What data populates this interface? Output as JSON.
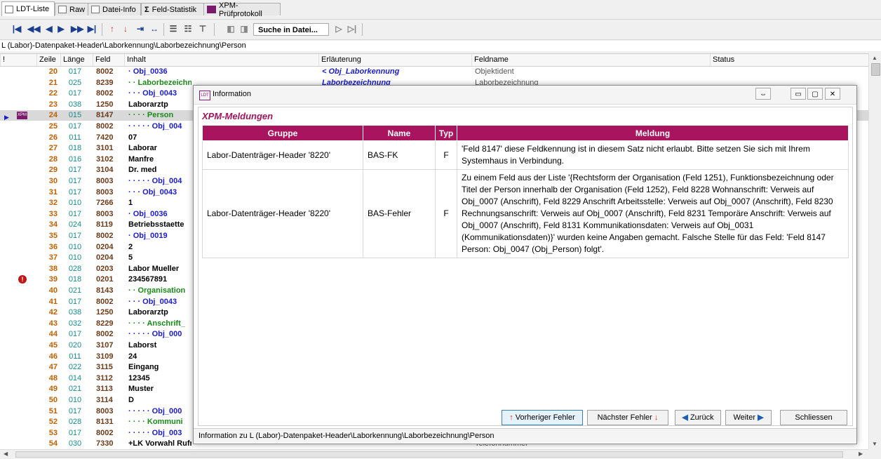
{
  "tabs": [
    {
      "label": "LDT-Liste",
      "icon": "list-icon"
    },
    {
      "label": "Raw",
      "icon": "document-icon"
    },
    {
      "label": "Datei-Info",
      "icon": "file-info-icon"
    },
    {
      "label": "Feld-Statistik",
      "icon": "sigma-icon"
    },
    {
      "label": "XPM-Prüfprotokoll",
      "icon": "xpm-icon"
    }
  ],
  "toolbar": {
    "search_label": "Suche in Datei...",
    "buttons": [
      "first",
      "prev-page",
      "prev",
      "next",
      "next-page",
      "last",
      "error-up",
      "error-down",
      "goto",
      "expand"
    ]
  },
  "path": "L (Labor)-Datenpaket-Header\\Laborkennung\\Laborbezeichnung\\Person",
  "grid": {
    "headers": [
      "!",
      "Zeile",
      "Länge",
      "Feld",
      "Inhalt",
      "Erläuterung",
      "Feldname",
      "Status"
    ],
    "rows": [
      {
        "zeile": "20",
        "laenge": "017",
        "feld": "8002",
        "inhalt": "· Obj_0036",
        "erl": "< Obj_Laborkennung",
        "fname": "Objektident"
      },
      {
        "zeile": "21",
        "laenge": "025",
        "feld": "8239",
        "inhalt": "· · Laborbezeichnung",
        "erl": "Laborbezeichnung",
        "fname": "Laborbezeichnung"
      },
      {
        "zeile": "22",
        "laenge": "017",
        "feld": "8002",
        "inhalt": "· · · Obj_0043",
        "erl": "",
        "fname": ""
      },
      {
        "zeile": "23",
        "laenge": "038",
        "feld": "1250",
        "inhalt": "Laborarztp",
        "erl": "",
        "fname": ""
      },
      {
        "zeile": "24",
        "laenge": "015",
        "feld": "8147",
        "inhalt": "· · · · Person",
        "erl": "",
        "fname": ""
      },
      {
        "zeile": "25",
        "laenge": "017",
        "feld": "8002",
        "inhalt": "· · · · · Obj_004",
        "erl": "",
        "fname": ""
      },
      {
        "zeile": "26",
        "laenge": "011",
        "feld": "7420",
        "inhalt": "07",
        "erl": "",
        "fname": ""
      },
      {
        "zeile": "27",
        "laenge": "018",
        "feld": "3101",
        "inhalt": "Laborar",
        "erl": "",
        "fname": ""
      },
      {
        "zeile": "28",
        "laenge": "016",
        "feld": "3102",
        "inhalt": "Manfre",
        "erl": "",
        "fname": ""
      },
      {
        "zeile": "29",
        "laenge": "017",
        "feld": "3104",
        "inhalt": "Dr. med",
        "erl": "",
        "fname": ""
      },
      {
        "zeile": "30",
        "laenge": "017",
        "feld": "8003",
        "inhalt": "· · · · · Obj_004",
        "erl": "",
        "fname": ""
      },
      {
        "zeile": "31",
        "laenge": "017",
        "feld": "8003",
        "inhalt": "· · · Obj_0043",
        "erl": "",
        "fname": ""
      },
      {
        "zeile": "32",
        "laenge": "010",
        "feld": "7266",
        "inhalt": "1",
        "erl": "",
        "fname": ""
      },
      {
        "zeile": "33",
        "laenge": "017",
        "feld": "8003",
        "inhalt": "· Obj_0036",
        "erl": "",
        "fname": ""
      },
      {
        "zeile": "34",
        "laenge": "024",
        "feld": "8119",
        "inhalt": "Betriebsstaette",
        "erl": "",
        "fname": ""
      },
      {
        "zeile": "35",
        "laenge": "017",
        "feld": "8002",
        "inhalt": "· Obj_0019",
        "erl": "",
        "fname": ""
      },
      {
        "zeile": "36",
        "laenge": "010",
        "feld": "0204",
        "inhalt": "2",
        "erl": "",
        "fname": ""
      },
      {
        "zeile": "37",
        "laenge": "010",
        "feld": "0204",
        "inhalt": "5",
        "erl": "",
        "fname": ""
      },
      {
        "zeile": "38",
        "laenge": "028",
        "feld": "0203",
        "inhalt": "Labor Mueller",
        "erl": "",
        "fname": ""
      },
      {
        "zeile": "39",
        "laenge": "018",
        "feld": "0201",
        "inhalt": "234567891",
        "erl": "",
        "fname": ""
      },
      {
        "zeile": "40",
        "laenge": "021",
        "feld": "8143",
        "inhalt": "· · Organisation",
        "erl": "",
        "fname": ""
      },
      {
        "zeile": "41",
        "laenge": "017",
        "feld": "8002",
        "inhalt": "· · · Obj_0043",
        "erl": "",
        "fname": ""
      },
      {
        "zeile": "42",
        "laenge": "038",
        "feld": "1250",
        "inhalt": "Laborarztp",
        "erl": "",
        "fname": ""
      },
      {
        "zeile": "43",
        "laenge": "032",
        "feld": "8229",
        "inhalt": "· · · · Anschrift_",
        "erl": "",
        "fname": ""
      },
      {
        "zeile": "44",
        "laenge": "017",
        "feld": "8002",
        "inhalt": "· · · · · Obj_000",
        "erl": "",
        "fname": ""
      },
      {
        "zeile": "45",
        "laenge": "020",
        "feld": "3107",
        "inhalt": "Laborst",
        "erl": "",
        "fname": ""
      },
      {
        "zeile": "46",
        "laenge": "011",
        "feld": "3109",
        "inhalt": "24",
        "erl": "",
        "fname": ""
      },
      {
        "zeile": "47",
        "laenge": "022",
        "feld": "3115",
        "inhalt": "Eingang",
        "erl": "",
        "fname": ""
      },
      {
        "zeile": "48",
        "laenge": "014",
        "feld": "3112",
        "inhalt": "12345",
        "erl": "",
        "fname": ""
      },
      {
        "zeile": "49",
        "laenge": "021",
        "feld": "3113",
        "inhalt": "Muster",
        "erl": "",
        "fname": ""
      },
      {
        "zeile": "50",
        "laenge": "010",
        "feld": "3114",
        "inhalt": "D",
        "erl": "",
        "fname": ""
      },
      {
        "zeile": "51",
        "laenge": "017",
        "feld": "8003",
        "inhalt": "· · · · · Obj_000",
        "erl": "",
        "fname": ""
      },
      {
        "zeile": "52",
        "laenge": "028",
        "feld": "8131",
        "inhalt": "· · · · Kommuni",
        "erl": "",
        "fname": ""
      },
      {
        "zeile": "53",
        "laenge": "017",
        "feld": "8002",
        "inhalt": "· · · · · Obj_003",
        "erl": "",
        "fname": ""
      },
      {
        "zeile": "54",
        "laenge": "030",
        "feld": "7330",
        "inhalt": "+LK Vorwahl Rufnummer",
        "erl": "",
        "fname": "Telefonnummer"
      }
    ]
  },
  "dialog": {
    "title": "Information",
    "section_heading": "XPM-Meldungen",
    "columns": [
      "Gruppe",
      "Name",
      "Typ",
      "Meldung"
    ],
    "rows": [
      {
        "gruppe": "Labor-Datenträger-Header '8220'",
        "name": "BAS-FK",
        "typ": "F",
        "meldung": "'Feld 8147' diese Feldkennung ist in diesem Satz nicht erlaubt. Bitte setzen Sie sich mit Ihrem Systemhaus in Verbindung."
      },
      {
        "gruppe": "Labor-Datenträger-Header '8220'",
        "name": "BAS-Fehler",
        "typ": "F",
        "meldung": "Zu einem Feld aus der Liste '{Rechtsform der Organisation (Feld 1251), Funktionsbezeichnung oder Titel der Person innerhalb der Organisation (Feld 1252), Feld 8228 Wohnanschrift: Verweis auf Obj_0007 (Anschrift), Feld 8229 Anschrift Arbeitsstelle: Verweis auf Obj_0007 (Anschrift), Feld 8230 Rechnungsanschrift: Verweis auf Obj_0007 (Anschrift), Feld 8231 Temporäre Anschrift: Verweis auf Obj_0007 (Anschrift), Feld 8131 Kommunikationsdaten: Verweis auf Obj_0031 (Kommunikationsdaten)}' wurden keine Angaben gemacht. Falsche Stelle für das Feld: 'Feld 8147 Person: Obj_0047 (Obj_Person) folgt'."
      }
    ],
    "buttons": {
      "prev_error": "Vorheriger Fehler",
      "next_error": "Nächster Fehler",
      "back": "Zurück",
      "forward": "Weiter",
      "close": "Schliessen"
    },
    "status": "Information zu L (Labor)-Datenpaket-Header\\Laborkennung\\Laborbezeichnung\\Person"
  },
  "colors": {
    "accent": "#a8155e",
    "line_number": "#c06000",
    "link_blue": "#1a1ad0",
    "group_green": "#1a8a1a"
  }
}
